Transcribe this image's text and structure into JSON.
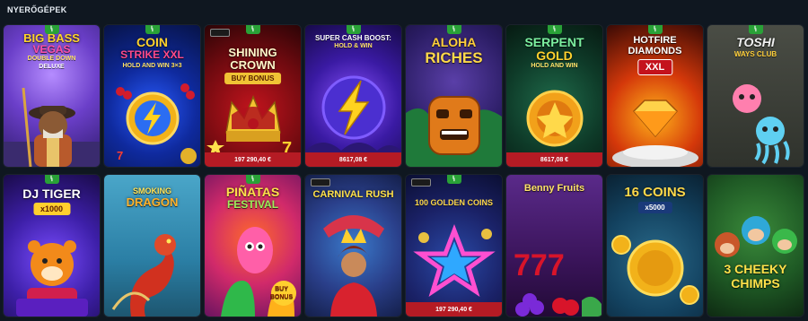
{
  "section": {
    "title": "NYERŐGÉPEK"
  },
  "badge_glyph": "ꝇ",
  "games": [
    {
      "name": "Big Bass Vegas Double Down Deluxe",
      "title_lines": [
        "BIG BASS",
        "VEGAS",
        "DOUBLE DOWN",
        "DELUXE"
      ],
      "badge": true,
      "jackpot": ""
    },
    {
      "name": "Coin Strike XXL Hold and Win 3x3",
      "title_lines": [
        "COIN",
        "STRIKE XXL",
        "HOLD AND WIN 3×3"
      ],
      "badge": true,
      "jackpot": ""
    },
    {
      "name": "Shining Crown Buy Bonus",
      "title_lines": [
        "SHINING",
        "CROWN",
        "BUY BONUS"
      ],
      "badge": true,
      "jackpot": "197 290,40 €"
    },
    {
      "name": "Super Cash Boost Hold & Win",
      "title_lines": [
        "SUPER CASH BOOST:",
        "HOLD & WIN"
      ],
      "badge": true,
      "jackpot": "8617,08 €"
    },
    {
      "name": "Aloha Riches",
      "title_lines": [
        "ALOHA",
        "RICHES"
      ],
      "badge": true,
      "jackpot": ""
    },
    {
      "name": "Serpent Gold Hold and Win",
      "title_lines": [
        "SERPENT",
        "GOLD",
        "HOLD AND WIN"
      ],
      "badge": true,
      "jackpot": "8617,08 €"
    },
    {
      "name": "Hotfire Diamonds XXL",
      "title_lines": [
        "HOTFIRE",
        "DIAMONDS",
        "XXL"
      ],
      "badge": true,
      "jackpot": ""
    },
    {
      "name": "Toshi Ways Club",
      "title_lines": [
        "TOSHI",
        "WAYS CLUB"
      ],
      "badge": true,
      "jackpot": ""
    },
    {
      "name": "DJ Tiger x1000",
      "title_lines": [
        "DJ TIGER",
        "x1000"
      ],
      "badge": true,
      "jackpot": ""
    },
    {
      "name": "Smoking Dragon",
      "title_lines": [
        "SMOKING",
        "DRAGON"
      ],
      "badge": false,
      "jackpot": ""
    },
    {
      "name": "Piñatas Festival Buy Bonus",
      "title_lines": [
        "PIÑATAS",
        "FESTIVAL",
        "BUY",
        "BONUS"
      ],
      "badge": true,
      "jackpot": ""
    },
    {
      "name": "Carnival Rush",
      "title_lines": [
        "CARNIVAL RUSH"
      ],
      "badge": false,
      "jackpot": ""
    },
    {
      "name": "100 Golden Coins",
      "title_lines": [
        "100 GOLDEN COINS"
      ],
      "badge": true,
      "jackpot": "197 290,40 €"
    },
    {
      "name": "Benny Fruits",
      "title_lines": [
        "Benny Fruits"
      ],
      "badge": false,
      "jackpot": ""
    },
    {
      "name": "16 Coins x5000",
      "title_lines": [
        "16 COINS",
        "x5000"
      ],
      "badge": false,
      "jackpot": ""
    },
    {
      "name": "3 Cheeky Chimps",
      "title_lines": [
        "3 CHEEKY",
        "CHIMPS"
      ],
      "badge": false,
      "jackpot": ""
    }
  ]
}
